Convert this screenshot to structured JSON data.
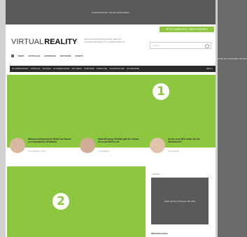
{
  "ads": {
    "top_banner": "SUPERBANNER 728×90 EVERGREEN",
    "right_skyscraper": "WIDE SKYSCRAPER 160×600",
    "side_rectangle": "MEDIUM RECTANGLE 300×250",
    "side_label": "ANZEIGE"
  },
  "header": {
    "login_button": "JETZT ANMELDEN / REGISTRIEREN",
    "logo_light": "VIRTUAL",
    "logo_bold": "REALITY",
    "tagline": "DAS MAGAZIN FÜR VIRTUAL REALITY, AUGMENTED REALITY & MIXED REALITY",
    "search_placeholder": "Suche..."
  },
  "nav": {
    "items": [
      "NEWS",
      "AKTUELLES",
      "HARDWARE",
      "SOFTWARE",
      "EVENTS"
    ]
  },
  "subnav": {
    "items": [
      "VR-ANWENDUNGEN",
      "VR-BRILLEN",
      "VR-SPIELE",
      "AR-ANWENDUNGEN",
      "360° VIDEOS",
      "INTERVIEWS",
      "FORSCHUNG",
      "VR-ENTWICKLUNG",
      "VR-HARDWARE"
    ],
    "more": "MEHR ▾"
  },
  "badges": {
    "one": "1",
    "two": "2"
  },
  "teasers": [
    {
      "title": "Metaverse-Experiment: Hinter der Nutzer von interaktiven VR-Welten",
      "meta": "Von Redaktion | 2 Min"
    },
    {
      "title": "Meta-Meinung: Realität gibt ein Virtual-Kurs und Brillen vor",
      "meta": "Von Redaktion"
    },
    {
      "title": "Ist die neue Welt realer als die Wirklichkeit?",
      "meta": "Von Redaktion"
    }
  ],
  "sidebar": {
    "heading": "MEISTGELESEN"
  }
}
